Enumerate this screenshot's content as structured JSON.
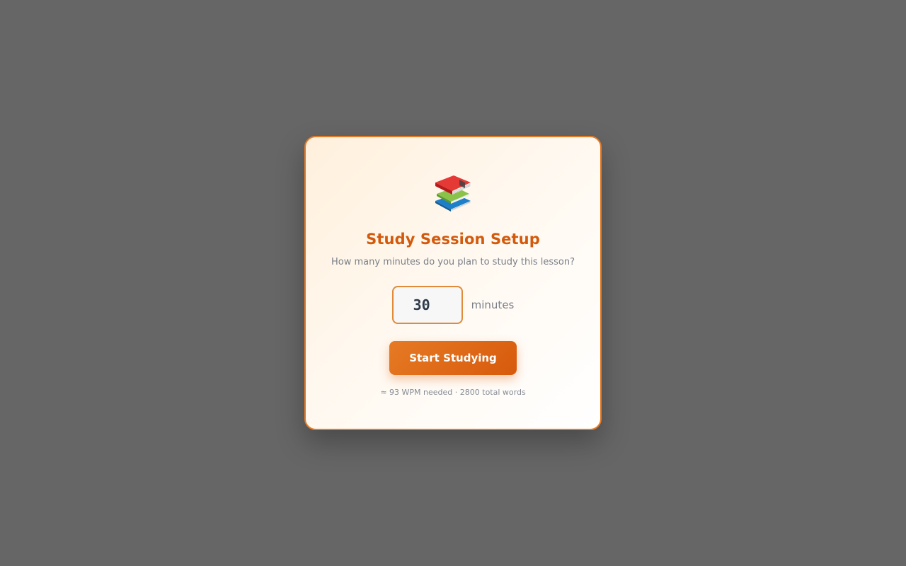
{
  "modal": {
    "icon": "books-icon",
    "title": "Study Session Setup",
    "subtitle": "How many minutes do you plan to study this lesson?",
    "minutes_value": "30",
    "unit_label": "minutes",
    "start_label": "Start Studying",
    "hint": "≈ 93 WPM needed · 2800 total words"
  },
  "colors": {
    "accent": "#d35a0c",
    "border": "#e47b26",
    "backdrop": "#666666"
  }
}
